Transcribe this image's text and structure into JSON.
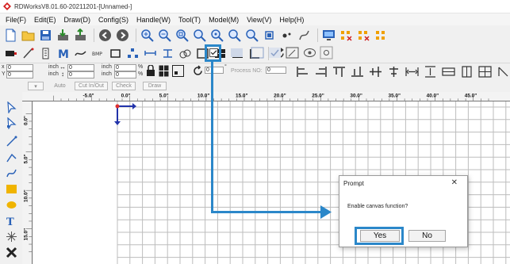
{
  "window": {
    "title": "RDWorksV8.01.60-20211201-[Unnamed-]"
  },
  "menu": [
    "File(F)",
    "Edit(E)",
    "Draw(D)",
    "Config(S)",
    "Handle(W)",
    "Tool(T)",
    "Model(M)",
    "View(V)",
    "Help(H)"
  ],
  "properties": {
    "x_label": "x",
    "x_value": "0",
    "y_label": "Y",
    "y_value": "0",
    "unit1": "inch",
    "unit2": "inch",
    "unit3": "inch",
    "unit4": "inch",
    "w_value": "0",
    "h_value": "0",
    "sx_value": "0",
    "sy_value": "0",
    "pct1": "%",
    "pct2": "%",
    "rotate_value": "0",
    "degree": "°",
    "process_no_label": "Process NO:",
    "process_no_value": "0"
  },
  "actions": {
    "auto": "Auto",
    "cut_in_out": "Cut In/Out",
    "check": "Check",
    "draw": "Draw"
  },
  "ruler": {
    "h_labels": [
      "-5.0\"",
      "0.0\"",
      "5.0\"",
      "10.0\"",
      "15.0\"",
      "20.0\"",
      "25.0\"",
      "30.0\"",
      "35.0\"",
      "40.0\"",
      "45.0\""
    ],
    "v_labels": [
      "0.0\"",
      "5.0\"",
      "10.0\"",
      "15.0\""
    ]
  },
  "dialog": {
    "title": "Prompt",
    "close": "✕",
    "message": "Enable canvas function?",
    "yes": "Yes",
    "no": "No"
  },
  "colors": {
    "highlight": "#2b87c9",
    "origin_red": "#e03030",
    "origin_blue": "#2233aa",
    "grid": "#bdbdbd"
  }
}
